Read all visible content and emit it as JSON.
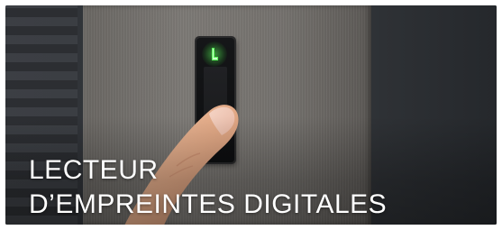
{
  "card": {
    "title_line1": "LECTEUR",
    "title_line2": "D’EMPREINTES DIGITALES"
  },
  "image": {
    "icon": "fingerprint-reader-photo",
    "led_color": "#3cff4a"
  }
}
